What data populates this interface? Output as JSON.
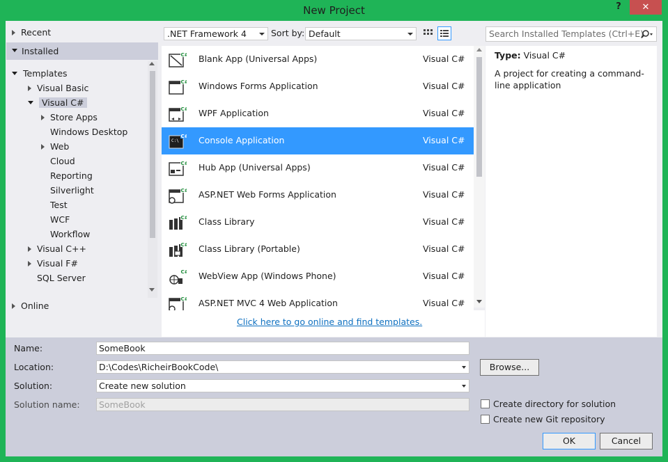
{
  "window": {
    "title": "New Project",
    "help_glyph": "?",
    "close_glyph": "✕"
  },
  "tree": {
    "recent": "Recent",
    "installed": "Installed",
    "templates": "Templates",
    "visual_basic": "Visual Basic",
    "visual_cs": "Visual C#",
    "cs_children": [
      "Store Apps",
      "Windows Desktop",
      "Web",
      "Cloud",
      "Reporting",
      "Silverlight",
      "Test",
      "WCF",
      "Workflow"
    ],
    "visual_cpp": "Visual C++",
    "visual_fs": "Visual F#",
    "sql_server": "SQL Server",
    "online": "Online"
  },
  "toolbar": {
    "framework": ".NET Framework 4",
    "sort_label": "Sort by:",
    "sort_value": "Default",
    "search_placeholder": "Search Installed Templates (Ctrl+E)"
  },
  "templates": [
    {
      "name": "Blank App (Universal Apps)",
      "lang": "Visual C#",
      "icon": "blank-app-icon"
    },
    {
      "name": "Windows Forms Application",
      "lang": "Visual C#",
      "icon": "windows-forms-icon"
    },
    {
      "name": "WPF Application",
      "lang": "Visual C#",
      "icon": "wpf-icon"
    },
    {
      "name": "Console Application",
      "lang": "Visual C#",
      "icon": "console-icon"
    },
    {
      "name": "Hub App (Universal Apps)",
      "lang": "Visual C#",
      "icon": "hub-app-icon"
    },
    {
      "name": "ASP.NET Web Forms Application",
      "lang": "Visual C#",
      "icon": "web-forms-icon"
    },
    {
      "name": "Class Library",
      "lang": "Visual C#",
      "icon": "class-library-icon"
    },
    {
      "name": "Class Library (Portable)",
      "lang": "Visual C#",
      "icon": "portable-library-icon"
    },
    {
      "name": "WebView App (Windows Phone)",
      "lang": "Visual C#",
      "icon": "webview-icon"
    },
    {
      "name": "ASP.NET MVC 4 Web Application",
      "lang": "Visual C#",
      "icon": "mvc-icon"
    }
  ],
  "selected_template": "Console Application",
  "online_link": "Click here to go online and find templates.",
  "info": {
    "type_label": "Type:",
    "type_value": "Visual C#",
    "description": "A project for creating a command-line application"
  },
  "form": {
    "name_label": "Name:",
    "name_value": "SomeBook",
    "location_label": "Location:",
    "location_value": "D:\\Codes\\RicheirBookCode\\",
    "solution_label": "Solution:",
    "solution_value": "Create new solution",
    "solution_name_label": "Solution name:",
    "solution_name_value": "SomeBook",
    "browse": "Browse...",
    "create_dir": "Create directory for solution",
    "create_git": "Create new Git repository",
    "ok": "OK",
    "cancel": "Cancel"
  },
  "colors": {
    "accent_border": "#1fb457",
    "selection": "#3399ff",
    "close": "#c75050",
    "link": "#0e70c0"
  }
}
